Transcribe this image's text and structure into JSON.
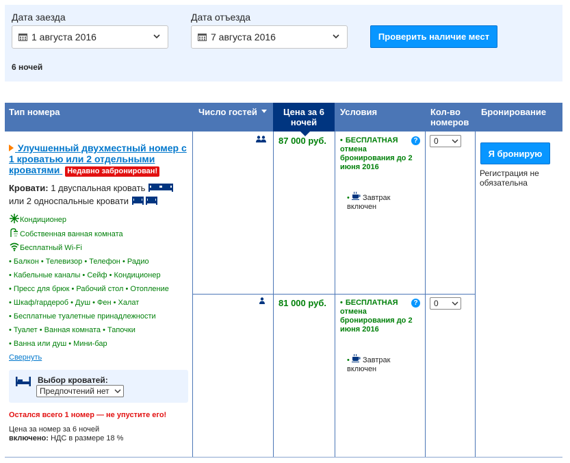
{
  "search": {
    "checkin_label": "Дата заезда",
    "checkin_value": "1 августа 2016",
    "checkout_label": "Дата отъезда",
    "checkout_value": "7 августа 2016",
    "check_button": "Проверить наличие мест",
    "nights": "6 ночей"
  },
  "table": {
    "headers": {
      "room_type": "Тип номера",
      "guests": "Число гостей",
      "price": "Цена за 6 ночей",
      "conditions": "Условия",
      "quantity": "Кол-во номеров",
      "booking": "Бронирование"
    }
  },
  "room": {
    "name": "Улучшенный двухместный номер с 1 кроватью или 2 отдельными кроватями",
    "badge": "Недавно забронирован!",
    "beds_label": "Кровати:",
    "beds_line1": "1 двуспальная кровать",
    "beds_line2": "или 2 односпальные кровати",
    "facilities": [
      {
        "icon": "snowflake-icon",
        "label": "Кондиционер"
      },
      {
        "icon": "shower-icon",
        "label": "Собственная ванная комната"
      },
      {
        "icon": "wifi-icon",
        "label": "Бесплатный Wi-Fi"
      }
    ],
    "amenity_lines": [
      "• Балкон  • Телевизор  • Телефон  • Радио",
      "• Кабельные каналы  • Сейф  • Кондиционер",
      "• Пресс для брюк  • Рабочий стол  • Отопление",
      "• Шкаф/гардероб  • Душ  • Фен  • Халат",
      "• Бесплатные туалетные принадлежности",
      "• Туалет  • Ванная комната  • Тапочки",
      "• Ванна или душ  • Мини-бар"
    ],
    "collapse": "Свернуть",
    "bed_choice_label": "Выбор кроватей:",
    "bed_choice_value": "Предпочтений нет",
    "urgent": "Остался всего 1 номер — не упустите его!",
    "price_note_line1": "Цена за номер за 6 ночей",
    "price_note_bold": "включено:",
    "price_note_rest": " НДС в размере 18 %"
  },
  "offers": [
    {
      "guests": 2,
      "price": "87 000 руб.",
      "conditions": "БЕСПЛАТНАЯ отмена бронирования до 2 июня 2016",
      "meal": "Завтрак включен",
      "quantity": "0"
    },
    {
      "guests": 1,
      "price": "81 000 руб.",
      "conditions": "БЕСПЛАТНАЯ отмена бронирования до 2 июня 2016",
      "meal": "Завтрак включен",
      "quantity": "0"
    }
  ],
  "booking": {
    "button": "Я бронирую",
    "note": "Регистрация не обязательна"
  },
  "colors": {
    "header_bg": "#4b76b6",
    "active_header_bg": "#003580",
    "panel_bg": "#ebf3ff",
    "button": "#0896ff",
    "green": "#008009",
    "red": "#e21111",
    "link": "#0077cc"
  }
}
